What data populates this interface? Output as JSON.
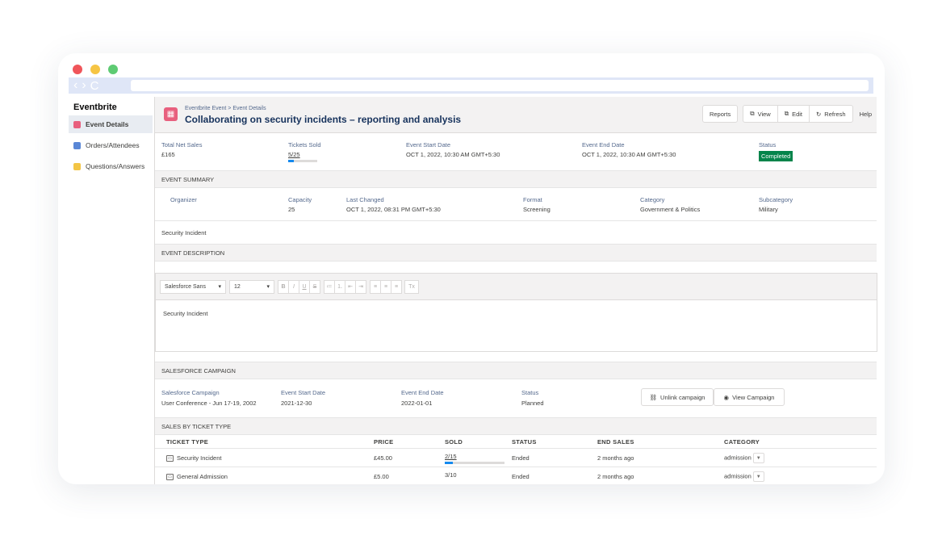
{
  "browser": {
    "nav_back": "‹",
    "nav_forward": "›",
    "nav_reload": "C"
  },
  "sidebar": {
    "brand": "Eventbrite",
    "items": [
      {
        "label": "Event Details",
        "icon": "calendar-icon",
        "color": "#e8607e"
      },
      {
        "label": "Orders/Attendees",
        "icon": "orders-icon",
        "color": "#5a87d6"
      },
      {
        "label": "Questions/Answers",
        "icon": "questions-icon",
        "color": "#f3c545"
      }
    ]
  },
  "header": {
    "breadcrumb": "Eventbrite Event > Event Details",
    "title": "Collaborating on security incidents – reporting and analysis",
    "buttons": {
      "reports": "Reports",
      "view": "View",
      "edit": "Edit",
      "refresh": "Refresh"
    },
    "help": "Help"
  },
  "summary_top": {
    "total_net_sales_label": "Total Net Sales",
    "total_net_sales": "£165",
    "tickets_sold_label": "Tickets Sold",
    "tickets_sold": "5/25",
    "tickets_sold_fraction": 0.2,
    "start_label": "Event Start Date",
    "start": "OCT 1, 2022, 10:30 AM GMT+5:30",
    "end_label": "Event End Date",
    "end": "OCT 1, 2022, 10:30 AM GMT+5:30",
    "status_label": "Status",
    "status": "Completed"
  },
  "event_summary": {
    "heading": "EVENT SUMMARY",
    "organizer_label": "Organizer",
    "organizer": "",
    "capacity_label": "Capacity",
    "capacity": "25",
    "last_changed_label": "Last Changed",
    "last_changed": "OCT 1, 2022, 08:31 PM GMT+5:30",
    "format_label": "Format",
    "format": "Screening",
    "category_label": "Category",
    "category": "Government & Politics",
    "subcategory_label": "Subcategory",
    "subcategory": "Military",
    "name": "Security Incident"
  },
  "event_description": {
    "heading": "EVENT DESCRIPTION",
    "font": "Salesforce Sans",
    "size": "12",
    "body": "Security Incident",
    "toolbar": [
      "B",
      "I",
      "U",
      "S",
      "≔",
      "⒈",
      "⇤",
      "⇥",
      "≡",
      "≡",
      "≡",
      "Tx"
    ]
  },
  "campaign": {
    "heading": "SALESFORCE CAMPAIGN",
    "campaign_label": "Salesforce Campaign",
    "campaign": "User Conference - Jun 17-19, 2002",
    "start_label": "Event Start Date",
    "start": "2021-12-30",
    "end_label": "Event End Date",
    "end": "2022-01-01",
    "status_label": "Status",
    "status": "Planned",
    "unlink": "Unlink campaign",
    "view": "View Campaign"
  },
  "tickets": {
    "heading": "SALES BY TICKET TYPE",
    "columns": [
      "TICKET TYPE",
      "PRICE",
      "SOLD",
      "STATUS",
      "END SALES",
      "CATEGORY"
    ],
    "rows": [
      {
        "type": "Security Incident",
        "price": "£45.00",
        "sold": "2/15",
        "sold_fraction": 0.133,
        "status": "Ended",
        "end_sales": "2 months ago",
        "category": "admission"
      },
      {
        "type": "General Admission",
        "price": "£5.00",
        "sold": "3/10",
        "sold_fraction": 0.3,
        "status": "Ended",
        "end_sales": "2 months ago",
        "category": "admission"
      }
    ]
  }
}
